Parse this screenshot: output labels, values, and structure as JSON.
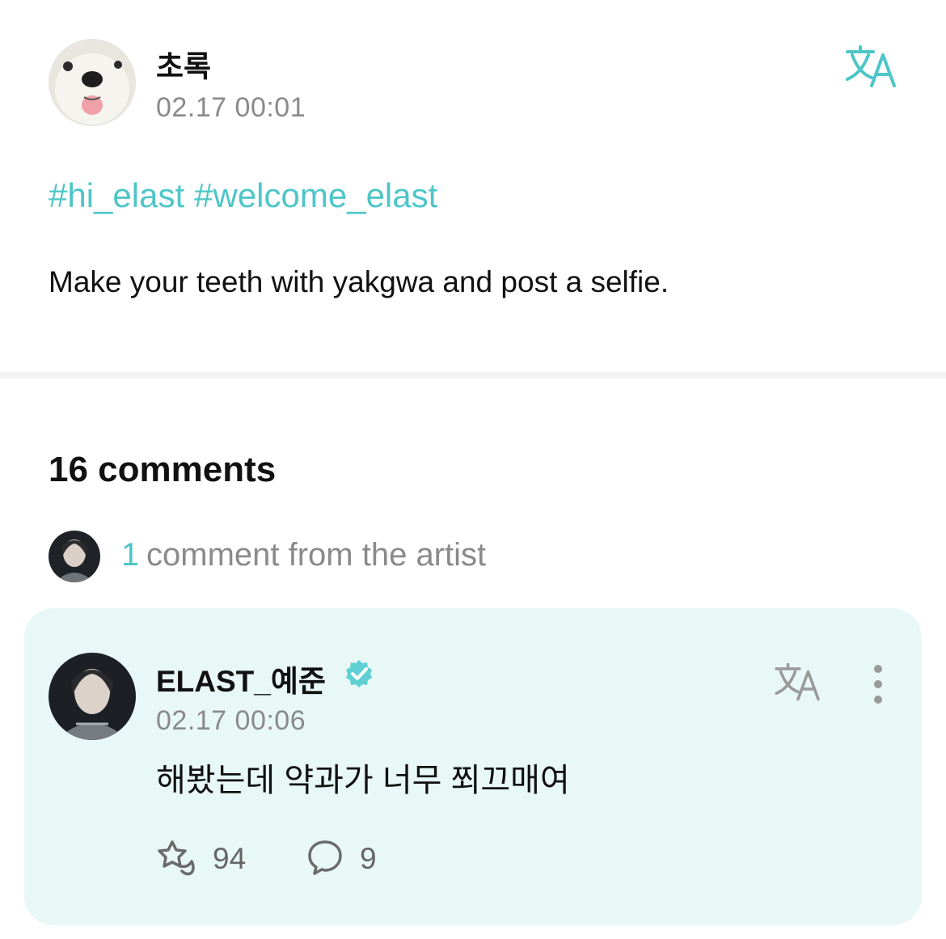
{
  "post": {
    "author": "초록",
    "time": "02.17 00:01",
    "hashtags": [
      "#hi_elast",
      "#welcome_elast"
    ],
    "body": "Make your teeth with yakgwa and post a selfie.",
    "translate_icon": "translate-icon"
  },
  "comments": {
    "title": "16 comments",
    "artist_count": "1",
    "artist_label": "comment from the artist"
  },
  "artist_comment": {
    "author": "ELAST_예준",
    "verified_icon": "verified-badge-icon",
    "time": "02.17 00:06",
    "text": "해봤는데 약과가 너무 쬐끄매여",
    "likes": "94",
    "replies": "9",
    "like_icon": "cheer-icon",
    "reply_icon": "speech-bubble-icon",
    "more_icon": "more-vertical-icon"
  },
  "colors": {
    "accent": "#4ec6c8",
    "card_bg": "#e8f8f6",
    "muted": "#8a8a8a",
    "text": "#111111"
  }
}
